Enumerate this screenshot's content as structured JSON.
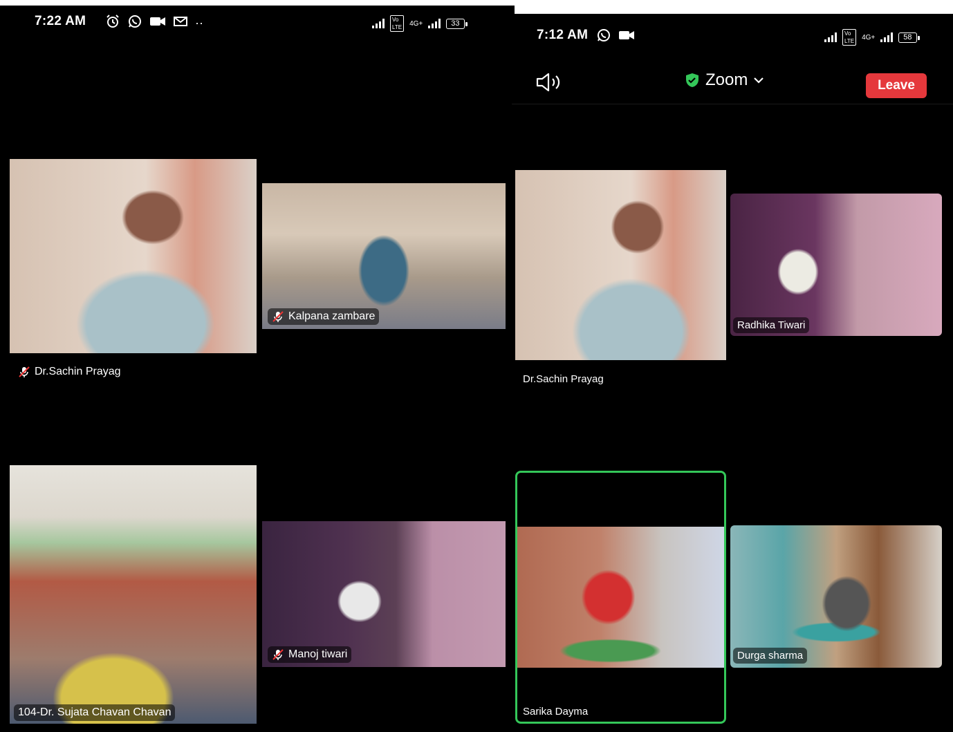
{
  "left_screen": {
    "status": {
      "time": "7:22 AM",
      "battery": "33",
      "network": "4G+"
    },
    "participants": [
      {
        "name": "Dr.Sachin Prayag",
        "muted": true
      },
      {
        "name": "Kalpana zambare",
        "muted": true
      },
      {
        "name": "104-Dr. Sujata Chavan Chavan",
        "muted": false
      },
      {
        "name": "Manoj tiwari",
        "muted": true
      }
    ]
  },
  "right_screen": {
    "status": {
      "time": "7:12 AM",
      "battery": "58",
      "network": "4G+"
    },
    "header": {
      "title": "Zoom",
      "leave_label": "Leave"
    },
    "participants": [
      {
        "name": "Dr.Sachin Prayag",
        "muted": false
      },
      {
        "name": "Radhika Tiwari",
        "muted": false
      },
      {
        "name": "Sarika Dayma",
        "muted": false,
        "active_speaker": true
      },
      {
        "name": "Durga sharma",
        "muted": false
      }
    ]
  },
  "colors": {
    "leave": "#e5383c",
    "active_speaker": "#34c759",
    "shield": "#34c759"
  }
}
